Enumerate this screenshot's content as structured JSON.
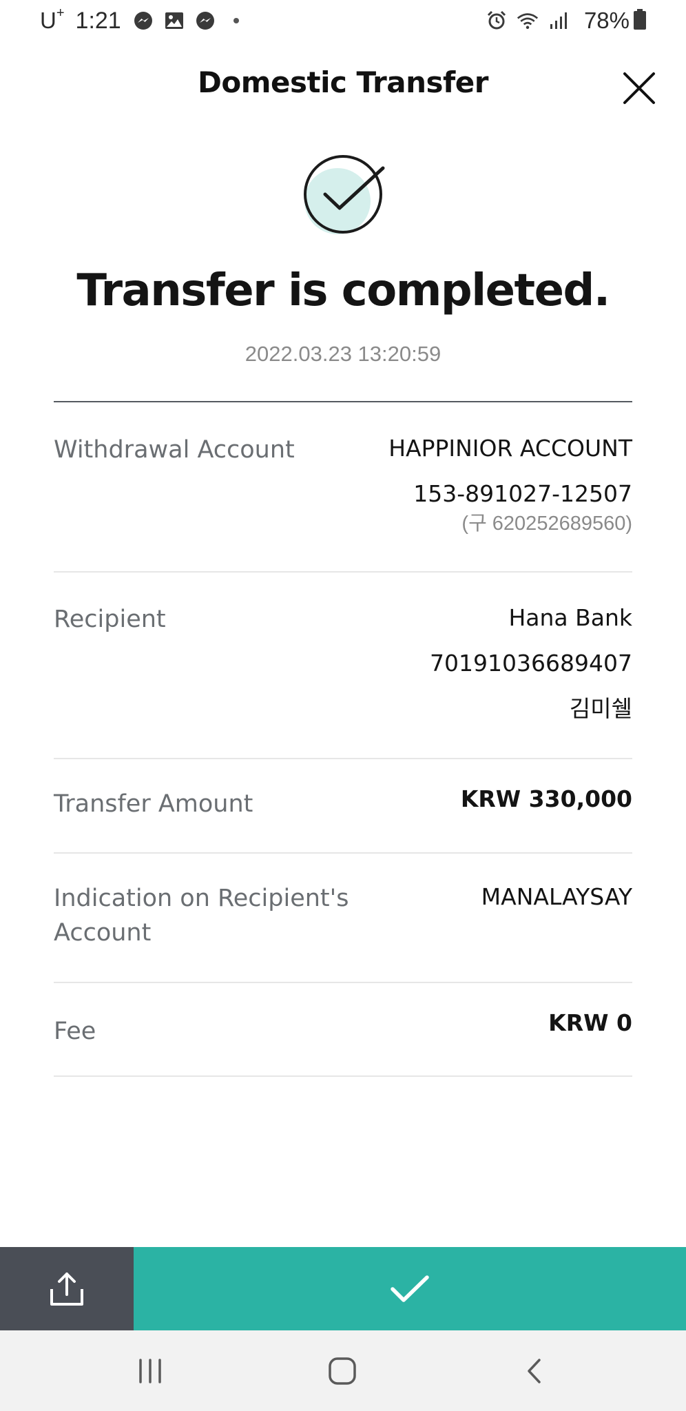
{
  "status_bar": {
    "carrier": "U",
    "carrier_sup": "+",
    "time": "1:21",
    "notification_icons": [
      "messenger-icon",
      "gallery-icon",
      "messenger-icon"
    ],
    "system_icons": [
      "alarm-icon",
      "wifi-icon",
      "signal-icon"
    ],
    "battery": "78%"
  },
  "header": {
    "title": "Domestic Transfer",
    "close_icon": "close-icon"
  },
  "result": {
    "icon": "check-circle-icon",
    "headline": "Transfer is completed.",
    "timestamp": "2022.03.23 13:20:59"
  },
  "details": {
    "withdrawal": {
      "label": "Withdrawal Account",
      "account_name": "HAPPINIOR ACCOUNT",
      "account_number": "153-891027-12507",
      "old_number": "(구 620252689560)"
    },
    "recipient": {
      "label": "Recipient",
      "bank": "Hana Bank",
      "account_number": "70191036689407",
      "name": "김미쉘"
    },
    "amount": {
      "label": "Transfer Amount",
      "value": "KRW 330,000"
    },
    "indication": {
      "label": "Indication on Recipient's Account",
      "value": "MANALAYSAY"
    },
    "fee": {
      "label": "Fee",
      "value": "KRW 0"
    }
  },
  "actions": {
    "share_icon": "share-icon",
    "confirm_icon": "check-icon",
    "share_color": "#4a4e56",
    "confirm_color": "#2bb3a4"
  },
  "nav_bar": {
    "icons": [
      "recent-apps-icon",
      "home-icon",
      "back-icon"
    ]
  },
  "colors": {
    "accent": "#2bb3a4",
    "accent_light": "#d5efec",
    "label_gray": "#6a6e72",
    "muted_gray": "#8a8a8a"
  }
}
